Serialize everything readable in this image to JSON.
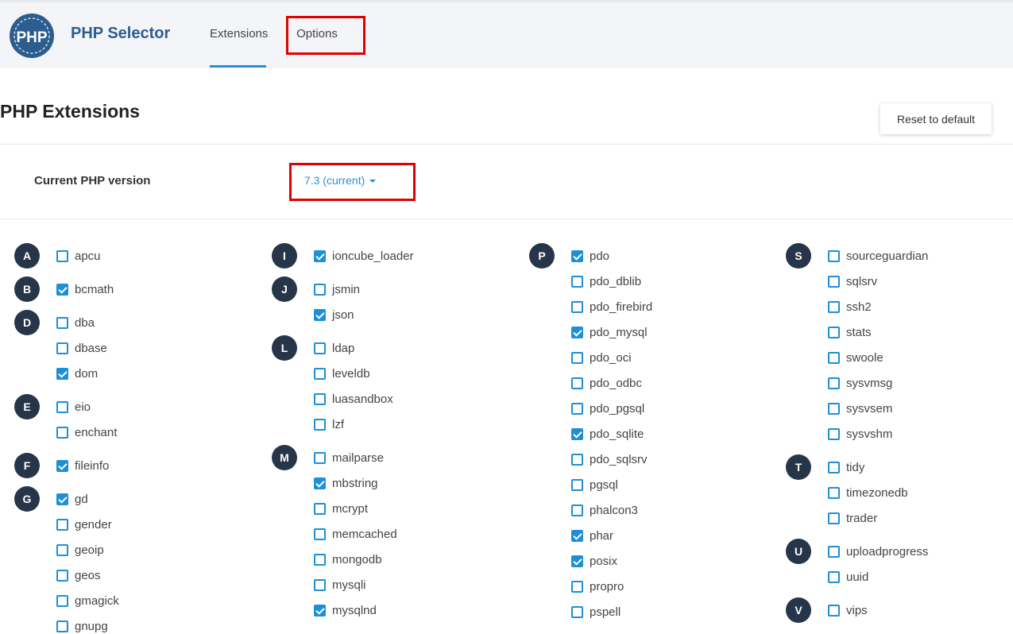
{
  "header": {
    "logo_text": "PHP",
    "app_title": "PHP Selector",
    "tabs": [
      {
        "label": "Extensions",
        "active": true
      },
      {
        "label": "Options",
        "active": false
      }
    ]
  },
  "page": {
    "title": "PHP Extensions",
    "reset_label": "Reset to default",
    "version_label": "Current PHP version",
    "version_value": "7.3 (current)"
  },
  "colors": {
    "accent": "#1e8fd6",
    "brand": "#2d5d8f",
    "letter_badge": "#263548",
    "highlight": "#e20000"
  },
  "extension_columns": [
    [
      {
        "letter": "A",
        "items": [
          {
            "name": "apcu",
            "checked": false
          }
        ]
      },
      {
        "letter": "B",
        "items": [
          {
            "name": "bcmath",
            "checked": true
          }
        ]
      },
      {
        "letter": "D",
        "items": [
          {
            "name": "dba",
            "checked": false
          },
          {
            "name": "dbase",
            "checked": false
          },
          {
            "name": "dom",
            "checked": true
          }
        ]
      },
      {
        "letter": "E",
        "items": [
          {
            "name": "eio",
            "checked": false
          },
          {
            "name": "enchant",
            "checked": false
          }
        ]
      },
      {
        "letter": "F",
        "items": [
          {
            "name": "fileinfo",
            "checked": true
          }
        ]
      },
      {
        "letter": "G",
        "items": [
          {
            "name": "gd",
            "checked": true
          },
          {
            "name": "gender",
            "checked": false
          },
          {
            "name": "geoip",
            "checked": false
          },
          {
            "name": "geos",
            "checked": false
          },
          {
            "name": "gmagick",
            "checked": false
          },
          {
            "name": "gnupg",
            "checked": false
          }
        ]
      }
    ],
    [
      {
        "letter": "I",
        "items": [
          {
            "name": "ioncube_loader",
            "checked": true
          }
        ]
      },
      {
        "letter": "J",
        "items": [
          {
            "name": "jsmin",
            "checked": false
          },
          {
            "name": "json",
            "checked": true
          }
        ]
      },
      {
        "letter": "L",
        "items": [
          {
            "name": "ldap",
            "checked": false
          },
          {
            "name": "leveldb",
            "checked": false
          },
          {
            "name": "luasandbox",
            "checked": false
          },
          {
            "name": "lzf",
            "checked": false
          }
        ]
      },
      {
        "letter": "M",
        "items": [
          {
            "name": "mailparse",
            "checked": false
          },
          {
            "name": "mbstring",
            "checked": true
          },
          {
            "name": "mcrypt",
            "checked": false
          },
          {
            "name": "memcached",
            "checked": false
          },
          {
            "name": "mongodb",
            "checked": false
          },
          {
            "name": "mysqli",
            "checked": false
          },
          {
            "name": "mysqlnd",
            "checked": true
          }
        ]
      }
    ],
    [
      {
        "letter": "P",
        "items": [
          {
            "name": "pdo",
            "checked": true
          },
          {
            "name": "pdo_dblib",
            "checked": false
          },
          {
            "name": "pdo_firebird",
            "checked": false
          },
          {
            "name": "pdo_mysql",
            "checked": true
          },
          {
            "name": "pdo_oci",
            "checked": false
          },
          {
            "name": "pdo_odbc",
            "checked": false
          },
          {
            "name": "pdo_pgsql",
            "checked": false
          },
          {
            "name": "pdo_sqlite",
            "checked": true
          },
          {
            "name": "pdo_sqlsrv",
            "checked": false
          },
          {
            "name": "pgsql",
            "checked": false
          },
          {
            "name": "phalcon3",
            "checked": false
          },
          {
            "name": "phar",
            "checked": true
          },
          {
            "name": "posix",
            "checked": true
          },
          {
            "name": "propro",
            "checked": false
          },
          {
            "name": "pspell",
            "checked": false
          }
        ]
      }
    ],
    [
      {
        "letter": "S",
        "items": [
          {
            "name": "sourceguardian",
            "checked": false
          },
          {
            "name": "sqlsrv",
            "checked": false
          },
          {
            "name": "ssh2",
            "checked": false
          },
          {
            "name": "stats",
            "checked": false
          },
          {
            "name": "swoole",
            "checked": false
          },
          {
            "name": "sysvmsg",
            "checked": false
          },
          {
            "name": "sysvsem",
            "checked": false
          },
          {
            "name": "sysvshm",
            "checked": false
          }
        ]
      },
      {
        "letter": "T",
        "items": [
          {
            "name": "tidy",
            "checked": false
          },
          {
            "name": "timezonedb",
            "checked": false
          },
          {
            "name": "trader",
            "checked": false
          }
        ]
      },
      {
        "letter": "U",
        "items": [
          {
            "name": "uploadprogress",
            "checked": false
          },
          {
            "name": "uuid",
            "checked": false
          }
        ]
      },
      {
        "letter": "V",
        "items": [
          {
            "name": "vips",
            "checked": false
          }
        ]
      }
    ]
  ]
}
